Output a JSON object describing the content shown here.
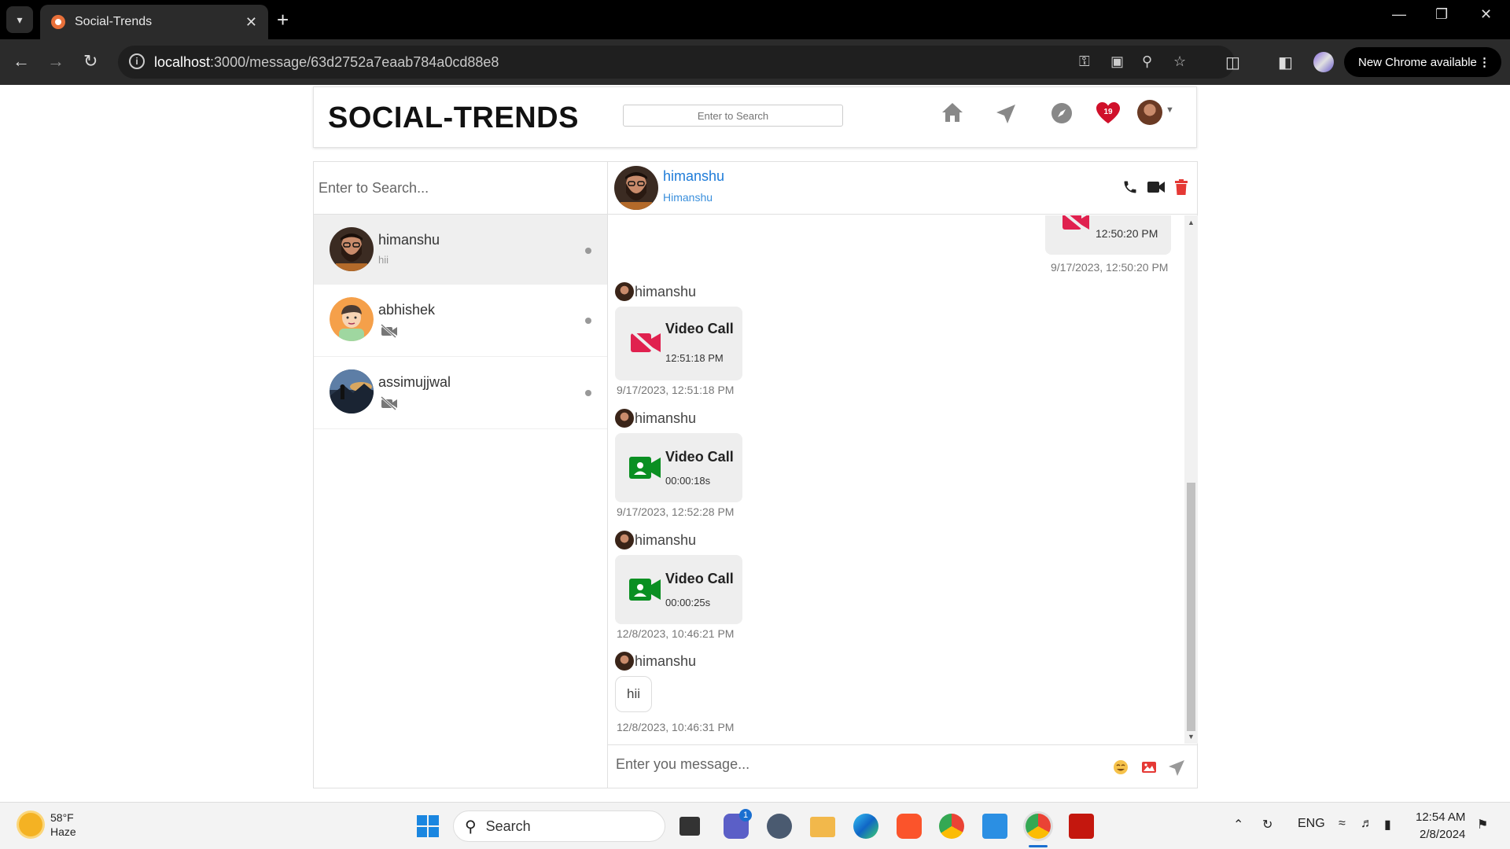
{
  "browser": {
    "tab_title": "Social-Trends",
    "url_host": "localhost",
    "url_rest": ":3000/message/63d2752a7eaab784a0cd88e8",
    "new_chrome_label": "New Chrome available"
  },
  "header": {
    "brand": "SOCIAL-TRENDS",
    "search_placeholder": "Enter to Search",
    "notification_count": "19"
  },
  "sidebar": {
    "search_placeholder": "Enter to Search...",
    "chats": [
      {
        "name": "himanshu",
        "last_message": "hii",
        "avatar": "bearded-man"
      },
      {
        "name": "abhishek",
        "last_message": "video-off-icon",
        "avatar": "cartoon-boy"
      },
      {
        "name": "assimujjwal",
        "last_message": "video-off-icon",
        "avatar": "landscape"
      }
    ]
  },
  "conversation": {
    "contact_name": "himanshu",
    "contact_fullname": "Himanshu",
    "messages": [
      {
        "type": "video-call-missed",
        "outgoing": true,
        "time": "12:50:20 PM",
        "timestamp": "9/17/2023, 12:50:20 PM"
      },
      {
        "sender": "himanshu",
        "type": "video-call-missed",
        "title": "Video Call",
        "detail": "12:51:18 PM",
        "timestamp": "9/17/2023, 12:51:18 PM"
      },
      {
        "sender": "himanshu",
        "type": "video-call",
        "title": "Video Call",
        "detail": "00:00:18s",
        "timestamp": "9/17/2023, 12:52:28 PM"
      },
      {
        "sender": "himanshu",
        "type": "video-call",
        "title": "Video Call",
        "detail": "00:00:25s",
        "timestamp": "12/8/2023, 10:46:21 PM"
      },
      {
        "sender": "himanshu",
        "type": "text",
        "text": "hii",
        "timestamp": "12/8/2023, 10:46:31 PM"
      }
    ],
    "composer_placeholder": "Enter you message..."
  },
  "taskbar": {
    "temperature": "58°F",
    "weather": "Haze",
    "search_label": "Search",
    "teams_badge": "1",
    "language": "ENG",
    "time": "12:54 AM",
    "date": "2/8/2024"
  },
  "colors": {
    "link_blue": "#1d7bd8",
    "missed_red": "#e0214f",
    "call_green": "#0a8f22",
    "delete_red": "#e53935"
  }
}
